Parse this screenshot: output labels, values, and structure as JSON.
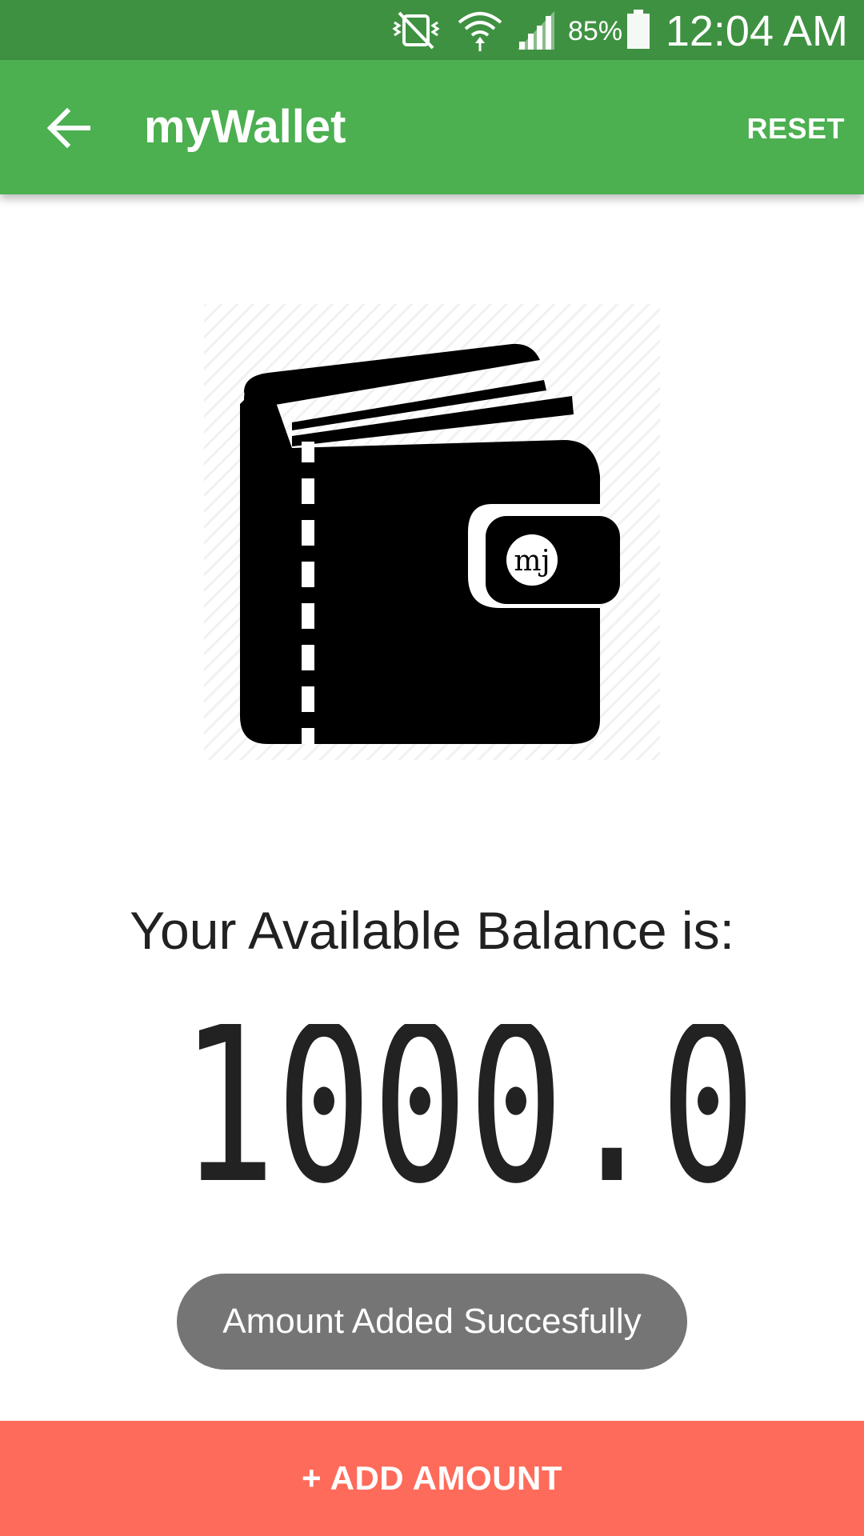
{
  "status_bar": {
    "battery_percent": "85%",
    "time": "12:04 AM",
    "icons": [
      "vibrate-mute-icon",
      "wifi-icon",
      "signal-icon",
      "battery-icon"
    ]
  },
  "app_bar": {
    "title": "myWallet",
    "reset_label": "RESET",
    "back_icon": "arrow-left-icon",
    "color": "#4caf50"
  },
  "wallet": {
    "logo_text": "mj",
    "icon": "wallet-icon"
  },
  "balance": {
    "label": "Your Available Balance is:",
    "value": "1000.0"
  },
  "toast": {
    "message": "Amount Added Succesfully",
    "color": "#757575"
  },
  "add_button": {
    "label": "+ ADD AMOUNT",
    "color": "#ff6b5a"
  }
}
